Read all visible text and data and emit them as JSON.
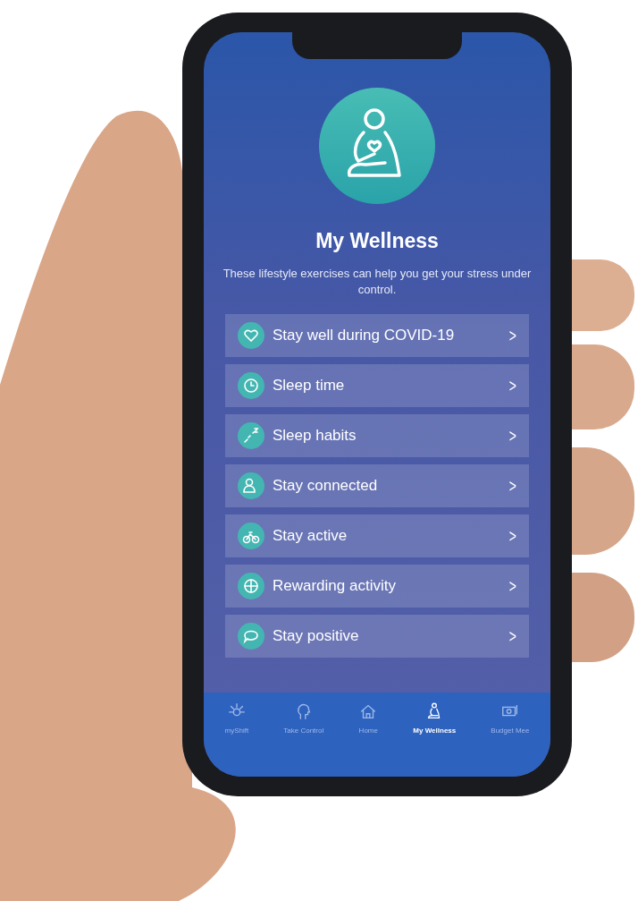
{
  "screen": {
    "title": "My Wellness",
    "subtitle": "These lifestyle exercises can help you get your stress under control.",
    "items": [
      {
        "label": "Stay well during COVID-19",
        "chevron": ">"
      },
      {
        "label": "Sleep time",
        "chevron": ">"
      },
      {
        "label": "Sleep habits",
        "chevron": ">"
      },
      {
        "label": "Stay connected",
        "chevron": ">"
      },
      {
        "label": "Stay active",
        "chevron": ">"
      },
      {
        "label": "Rewarding activity",
        "chevron": ">"
      },
      {
        "label": "Stay positive",
        "chevron": ">"
      }
    ],
    "tab_bar": [
      {
        "label": "myShift",
        "selected": false
      },
      {
        "label": "Take Control",
        "selected": false
      },
      {
        "label": "Home",
        "selected": false
      },
      {
        "label": "My Wellness",
        "selected": true
      },
      {
        "label": "Budget Mee",
        "selected": false
      }
    ]
  }
}
